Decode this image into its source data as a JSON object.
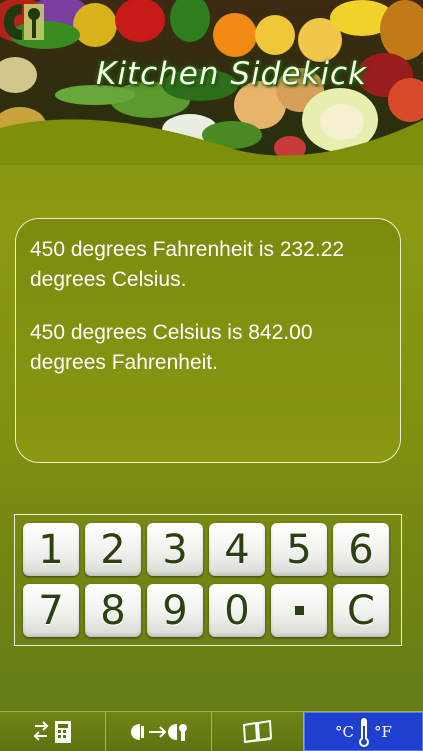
{
  "header": {
    "app_title": "Kitchen Sidekick"
  },
  "output": {
    "line1": "450 degrees Fahrenheit is 232.22 degrees Celsius.",
    "line2": "450 degrees Celsius is 842.00 degrees Fahrenheit."
  },
  "keypad": {
    "row1": [
      "1",
      "2",
      "3",
      "4",
      "5",
      "6"
    ],
    "row2": [
      "7",
      "8",
      "9",
      "0",
      "C"
    ]
  },
  "tabbar": {
    "tabs": [
      {
        "icon": "calculator-swap-icon"
      },
      {
        "icon": "units-convert-icon"
      },
      {
        "icon": "book-icon"
      },
      {
        "icon": "thermometer-icon",
        "left_label": "°C",
        "right_label": "°F",
        "active": true
      }
    ],
    "active_color": "#1f3fcf"
  },
  "colors": {
    "background": "#8c9a12",
    "key_text": "#2e3f12",
    "title_text": "#f3ffe8"
  }
}
